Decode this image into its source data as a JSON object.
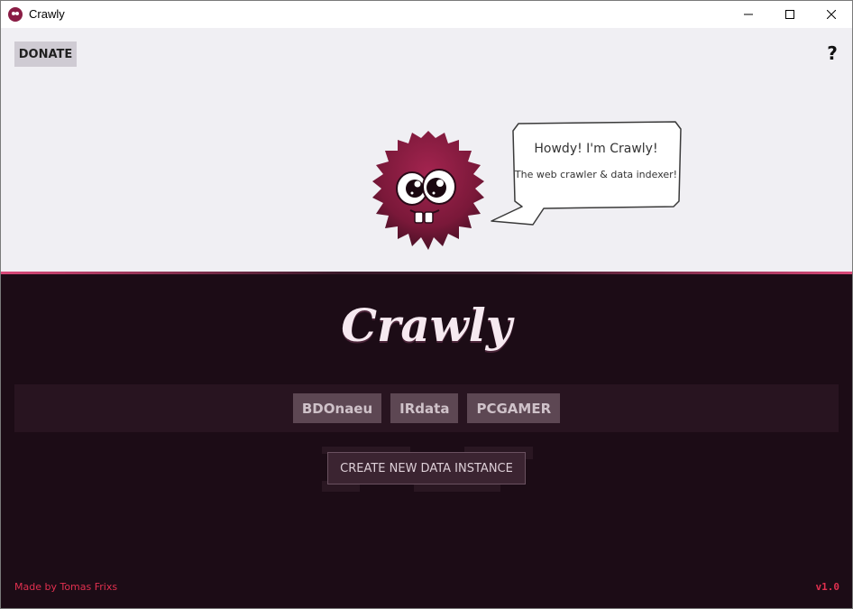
{
  "window": {
    "title": "Crawly",
    "controls": [
      "minimize-icon",
      "maximize-icon",
      "close-icon"
    ]
  },
  "hero": {
    "donate_label": "DONATE",
    "help_label": "?",
    "speech": {
      "line1": "Howdy!  I'm Crawly!",
      "line2": "The web crawler & data indexer!"
    }
  },
  "main": {
    "brand": "Crawly",
    "instances": [
      {
        "label": "BDOnaeu"
      },
      {
        "label": "IRdata"
      },
      {
        "label": "PCGAMER"
      }
    ],
    "create_label": "CREATE NEW DATA INSTANCE"
  },
  "footer": {
    "credit": "Made by Tomas Frixs",
    "version": "v1.0"
  },
  "colors": {
    "dark_bg": "#1c0c16",
    "light_bg": "#f0eff3",
    "accent": "#e0304f",
    "mascot": "#8a1d45"
  }
}
